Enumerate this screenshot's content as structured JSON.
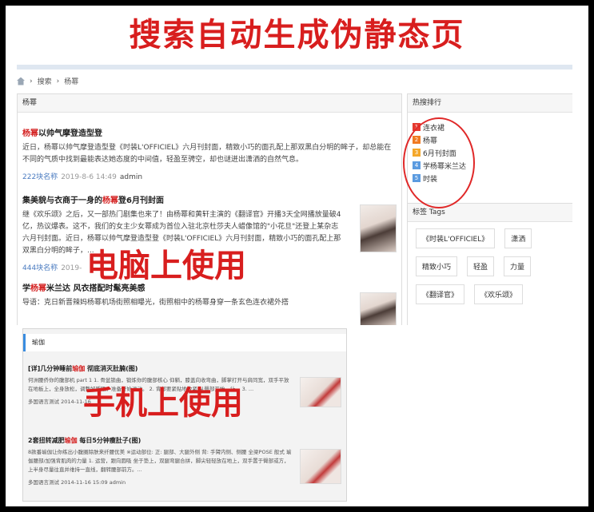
{
  "banner_title": "搜索自动生成伪静态页",
  "desktop": {
    "breadcrumb": [
      "搜索",
      "杨幂"
    ],
    "main_header": "杨幂",
    "articles": [
      {
        "title_prefix": "",
        "title_hl": "杨幂",
        "title_suffix": "以帅气摩登造型登",
        "body": "近日，杨幂以帅气摩登造型登《时装L'OFFICIEL》六月刊封面，精致小巧的面孔配上那双黑白分明的眸子，却总能在不同的气质中找到最能表达她态度的中间值，轻盈至骋空，却也谜迸出潇洒的自然气息。",
        "meta_site": "222块名称",
        "meta_date": "2019-8-6 14:49",
        "meta_author": "admin"
      },
      {
        "title_prefix": "集美貌与衣商于一身的",
        "title_hl": "杨幂",
        "title_suffix": "登6月刊封面",
        "body": "继《欢乐颂》之后，又一部热门剧集也来了！由杨幂和黄轩主演的《翻译官》开播3天全网播放量破4亿，热议爆表。这不，我们的女主少女幂成为首位入驻北京杜莎夫人蜡像馆的\"小花旦\"还登上某杂志六月刊封面。近日，杨幂以帅气摩登造型登《时装L'OFFICIEL》六月刊封面，精致小巧的面孔配上那双黑白分明的眸子，...",
        "meta_site": "444块名称",
        "meta_date": "2019-",
        "meta_author": ""
      },
      {
        "title_prefix": "学",
        "title_hl": "杨幂",
        "title_suffix": "米兰达 风衣搭配时髦亮美感",
        "body": "导语：克日新晋辣妈杨幂机场街照相曝光，街照相中的杨幂身穿一条玄色连衣裙外搭",
        "meta_site": "",
        "meta_date": "",
        "meta_author": ""
      }
    ],
    "hot_header": "热搜排行",
    "hot_items": [
      {
        "rank": "1",
        "label": "连衣裙",
        "color": "#e53a2f"
      },
      {
        "rank": "2",
        "label": "杨幂",
        "color": "#f07a22"
      },
      {
        "rank": "3",
        "label": "6月刊封面",
        "color": "#f4a72a"
      },
      {
        "rank": "4",
        "label": "学杨幂米兰达",
        "color": "#5b9be0"
      },
      {
        "rank": "5",
        "label": "时装",
        "color": "#5b9be0"
      }
    ],
    "tags_header": "标签 Tags",
    "tags": [
      "《时装L'OFFICIEL》",
      "潇洒",
      "精致小巧",
      "轻盈",
      "力量",
      "《翻译官》",
      "《欢乐颂》"
    ]
  },
  "label_pc": "电脑上使用",
  "mobile": {
    "header": "瑜伽",
    "articles": [
      {
        "title_prefix": "[详]几分钟睡前",
        "title_hl": "瑜伽",
        "title_suffix": " 彻底消灭肚腩(图)",
        "body": "何洲腰侨你的腹部机 part 1 1. 骨盆锁曲，锻炼你的腹部核心 仰躺，膝盖向收弯曲，脚掌打开与肩同宽，双手平放在地板上，全身放松，调整好呼吸，准备开始运动。 2. 背部要紧贴地收紧 从臀部开始，让... 3. ...",
        "meta": "多国语言测试 2014-11-16"
      },
      {
        "title_prefix": "2套扭转减肥",
        "title_hl": "瑜伽",
        "title_suffix": " 每日5分钟瘦肚子(图)",
        "body": "8款番瑜伽让你练出小腹圈除肤来纤腰优美 ※运动部位: 正: 腿部、大腿外侧 背: 手臂内侧、侧腰 全梁POSE 般式 瑜伽腰部/加强背肌肉的力量 1. 运营，跟向圆吸 坐于垫上，双腿弯腿合拼，脚尖轻轻放在地上，双手置于臀部或方，上半身尽量往直并维持一直线，翻转腰部前方。...",
        "meta": "多国语言测试 2014-11-16 15:09 admin"
      }
    ]
  },
  "label_mobile": "手机上使用",
  "colors": {
    "accent_red": "#d81e1e",
    "link_blue": "#4a7bc0",
    "mobile_bar": "#3a8de0"
  }
}
